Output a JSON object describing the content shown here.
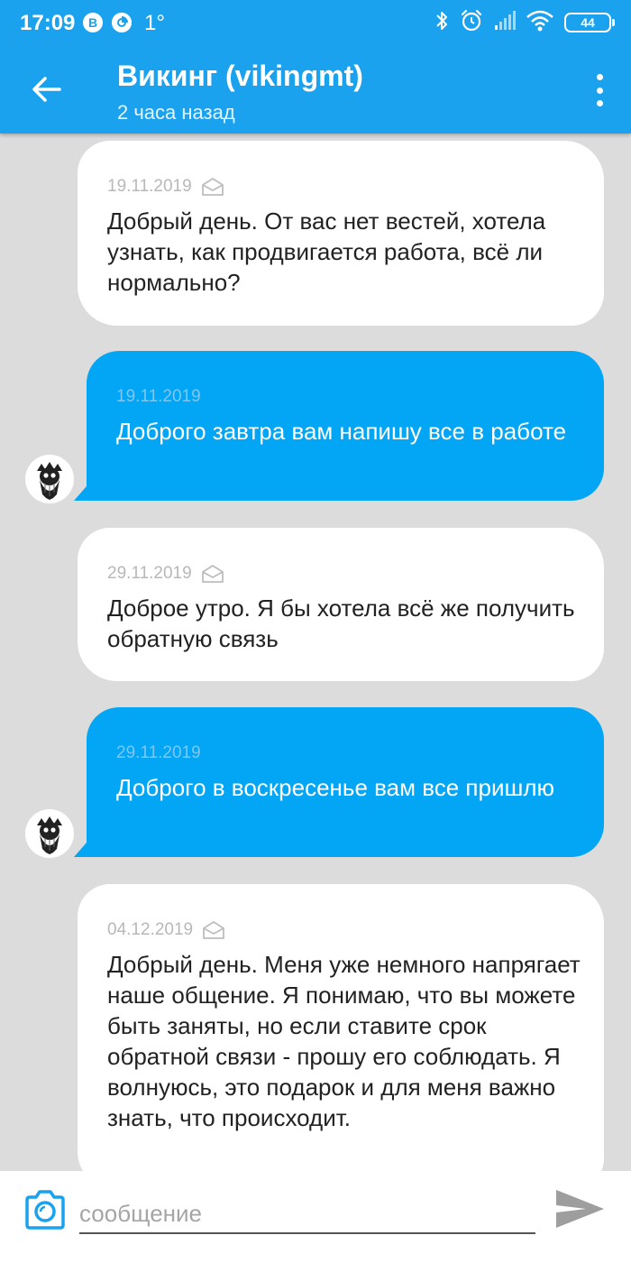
{
  "status_bar": {
    "time": "17:09",
    "badge_1": "В",
    "temperature": "1°",
    "battery": "44",
    "icons": [
      "vk-icon",
      "sync-icon",
      "bluetooth-icon",
      "alarm-icon",
      "signal-icon",
      "wifi-icon",
      "battery-icon"
    ]
  },
  "header": {
    "title": "Викинг (vikingmt)",
    "subtitle": "2 часа назад",
    "back_icon": "arrow-left-icon",
    "menu_icon": "more-vert-icon"
  },
  "messages": [
    {
      "direction": "in",
      "date": "19.11.2019",
      "read_icon": "envelope-open-icon",
      "text": "Добрый день. От вас нет вестей, хотела узнать, как продвигается работа, всё ли нормально?"
    },
    {
      "direction": "out",
      "date": "19.11.2019",
      "text": "Доброго завтра вам напишу все в работе"
    },
    {
      "direction": "in",
      "date": "29.11.2019",
      "read_icon": "envelope-open-icon",
      "text": "Доброе утро. Я бы хотела всё же получить обратную связь"
    },
    {
      "direction": "out",
      "date": "29.11.2019",
      "text": "Доброго в воскресенье вам все пришлю"
    },
    {
      "direction": "in",
      "date": "04.12.2019",
      "read_icon": "envelope-open-icon",
      "text": "Добрый день. Меня уже немного напрягает наше общение. Я понимаю, что вы можете быть заняты, но если ставите срок обратной связи - прошу его соблюдать. Я волнуюсь, это подарок и для меня важно знать, что происходит."
    }
  ],
  "composer": {
    "placeholder": "сообщение",
    "value": "",
    "camera_icon": "camera-icon",
    "send_icon": "send-icon"
  },
  "colors": {
    "accent": "#1aa2ee",
    "outgoing_bubble": "#03a5f5",
    "incoming_bubble": "#ffffff",
    "background": "#dcdcdc"
  }
}
